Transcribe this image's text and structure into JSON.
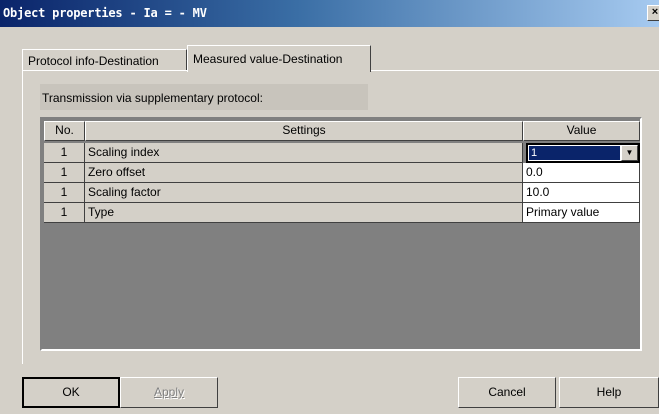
{
  "window": {
    "title": "Object properties - Ia  = - MV",
    "close_glyph": "×"
  },
  "tabs": [
    {
      "label": "Protocol info-Destination",
      "active": false
    },
    {
      "label": "Measured value-Destination",
      "active": true
    }
  ],
  "transmission_label": "Transmission via supplementary protocol:",
  "table": {
    "headers": {
      "no": "No.",
      "settings": "Settings",
      "value": "Value"
    },
    "rows": [
      {
        "no": "1",
        "setting": "Scaling index",
        "value": "1"
      },
      {
        "no": "1",
        "setting": "Zero offset",
        "value": "0.0"
      },
      {
        "no": "1",
        "setting": "Scaling factor",
        "value": "10.0"
      },
      {
        "no": "1",
        "setting": "Type",
        "value": "Primary value"
      }
    ]
  },
  "buttons": {
    "ok": "OK",
    "apply": "Apply",
    "cancel": "Cancel",
    "help": "Help"
  },
  "colors": {
    "title_bar": "#0a246a",
    "selection": "#0a246a",
    "grid_background": "#808080"
  },
  "icons": {
    "dropdown": "chevron-down-icon",
    "close": "close-icon"
  }
}
